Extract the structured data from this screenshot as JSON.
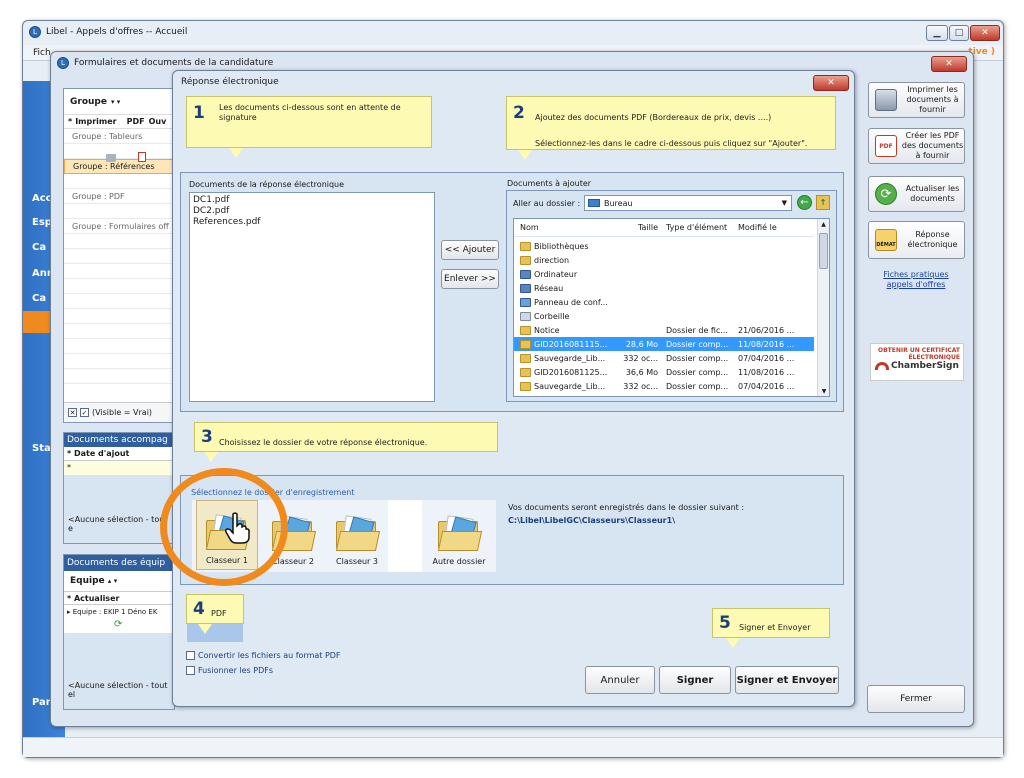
{
  "main_window": {
    "title": "Libel - Appels d'offres -- Accueil",
    "menu_first": "Fich",
    "status_right": "tive )"
  },
  "sidebar": {
    "items": [
      "Acc",
      "Esp",
      "Ca",
      "Ann",
      "Ca",
      "Sta",
      "Par"
    ]
  },
  "form_window": {
    "title": "Formulaires et documents de la candidature"
  },
  "left_panel": {
    "group_header": "Groupe",
    "col_print": "Imprimer",
    "col_pdf": "PDF",
    "col_ouv": "Ouv",
    "groups": [
      "Groupe : Tableurs",
      "Groupe : Références",
      "Groupe : PDF",
      "Groupe : Formulaires off"
    ],
    "visible_filter": "(Visible = Vrai)",
    "docs_accomp_title": "Documents accompag",
    "col_date_ajout": "Date d'ajout",
    "no_selection_1": "<Aucune sélection - tout e",
    "docs_equipe_title": "Documents des équip",
    "equipe_header": "Equipe",
    "col_actualiser": "Actualiser",
    "equipe_row": "Equipe : EKIP 1 Déno EK",
    "no_selection_2": "<Aucune sélection - tout el"
  },
  "right_actions": {
    "print": "Imprimer les documents à fournir",
    "create_pdf": "Créer les PDF des documents à fournir",
    "refresh": "Actualiser les documents",
    "electronic": "Réponse électronique",
    "electronic_badge": "DÉMAT",
    "fiches_link": "Fiches pratiques appels d'offres",
    "cert_line1": "OBTENIR UN CERTIFICAT",
    "cert_line2": "ÉLECTRONIQUE",
    "cert_brand": "ChamberSign",
    "close_btn": "Fermer"
  },
  "dialog": {
    "title": "Réponse électronique",
    "callout1_num": "1",
    "callout1_text": "Les documents ci-dessous sont en attente de signature",
    "callout2_num": "2",
    "callout2_line1": "Ajoutez des documents PDF (Bordereaux de prix, devis ....)",
    "callout2_line2": "Sélectionnez-les dans le cadre  ci-dessous puis cliquez sur \"Ajouter\".",
    "callout3_num": "3",
    "callout3_text": "Choisissez le dossier de votre réponse électronique.",
    "callout4_num": "4",
    "callout4_text": "PDF",
    "callout5_num": "5",
    "callout5_text": "Signer et Envoyer",
    "docs_label": "Documents de la réponse électronique",
    "docs_list": [
      "DC1.pdf",
      "DC2.pdf",
      "References.pdf"
    ],
    "add_btn": "<< Ajouter",
    "remove_btn": "Enlever >>",
    "add_docs_label": "Documents à ajouter",
    "goto_label": "Aller au dossier :",
    "goto_value": "Bureau",
    "file_cols": {
      "name": "Nom",
      "size": "Taille",
      "type": "Type d'élément",
      "modified": "Modifié le"
    },
    "files": [
      {
        "name": "Bibliothèques",
        "size": "",
        "type": "",
        "modified": ""
      },
      {
        "name": "direction",
        "size": "",
        "type": "",
        "modified": ""
      },
      {
        "name": "Ordinateur",
        "size": "",
        "type": "",
        "modified": ""
      },
      {
        "name": "Réseau",
        "size": "",
        "type": "",
        "modified": ""
      },
      {
        "name": "Panneau de conf...",
        "size": "",
        "type": "",
        "modified": ""
      },
      {
        "name": "Corbeille",
        "size": "",
        "type": "",
        "modified": ""
      },
      {
        "name": "Notice",
        "size": "",
        "type": "Dossier de fic...",
        "modified": "21/06/2016 ..."
      },
      {
        "name": "GID2016081115...",
        "size": "28,6 Mo",
        "type": "Dossier comp...",
        "modified": "11/08/2016 ..."
      },
      {
        "name": "Sauvegarde_Lib...",
        "size": "332 oc...",
        "type": "Dossier comp...",
        "modified": "07/04/2016 ..."
      },
      {
        "name": "GID2016081125...",
        "size": "36,6 Mo",
        "type": "Dossier comp...",
        "modified": "11/08/2016 ..."
      },
      {
        "name": "Sauvegarde_Lib...",
        "size": "332 oc...",
        "type": "Dossier comp...",
        "modified": "07/04/2016 ..."
      }
    ],
    "folder_section_label": "Sélectionnez le dossier d'enregistrement",
    "folders": [
      "Classeur 1",
      "Classeur 2",
      "Classeur 3",
      "Autre dossier"
    ],
    "save_info": "Vos documents seront enregistrés dans le dossier suivant :",
    "save_path": "C:\\Libel\\LibelGC\\Classeurs\\Classeur1\\",
    "convert_pdf": "Convertir les fichiers au format PDF",
    "merge_pdf": "Fusionner les PDFs",
    "cancel_btn": "Annuler",
    "sign_btn": "Signer",
    "sign_send_btn": "Signer et Envoyer"
  },
  "colors": {
    "accent": "#f08a1c",
    "callout": "#fdfbb3",
    "selected_row": "#3399ff",
    "brand_blue": "#1a3f7c"
  }
}
